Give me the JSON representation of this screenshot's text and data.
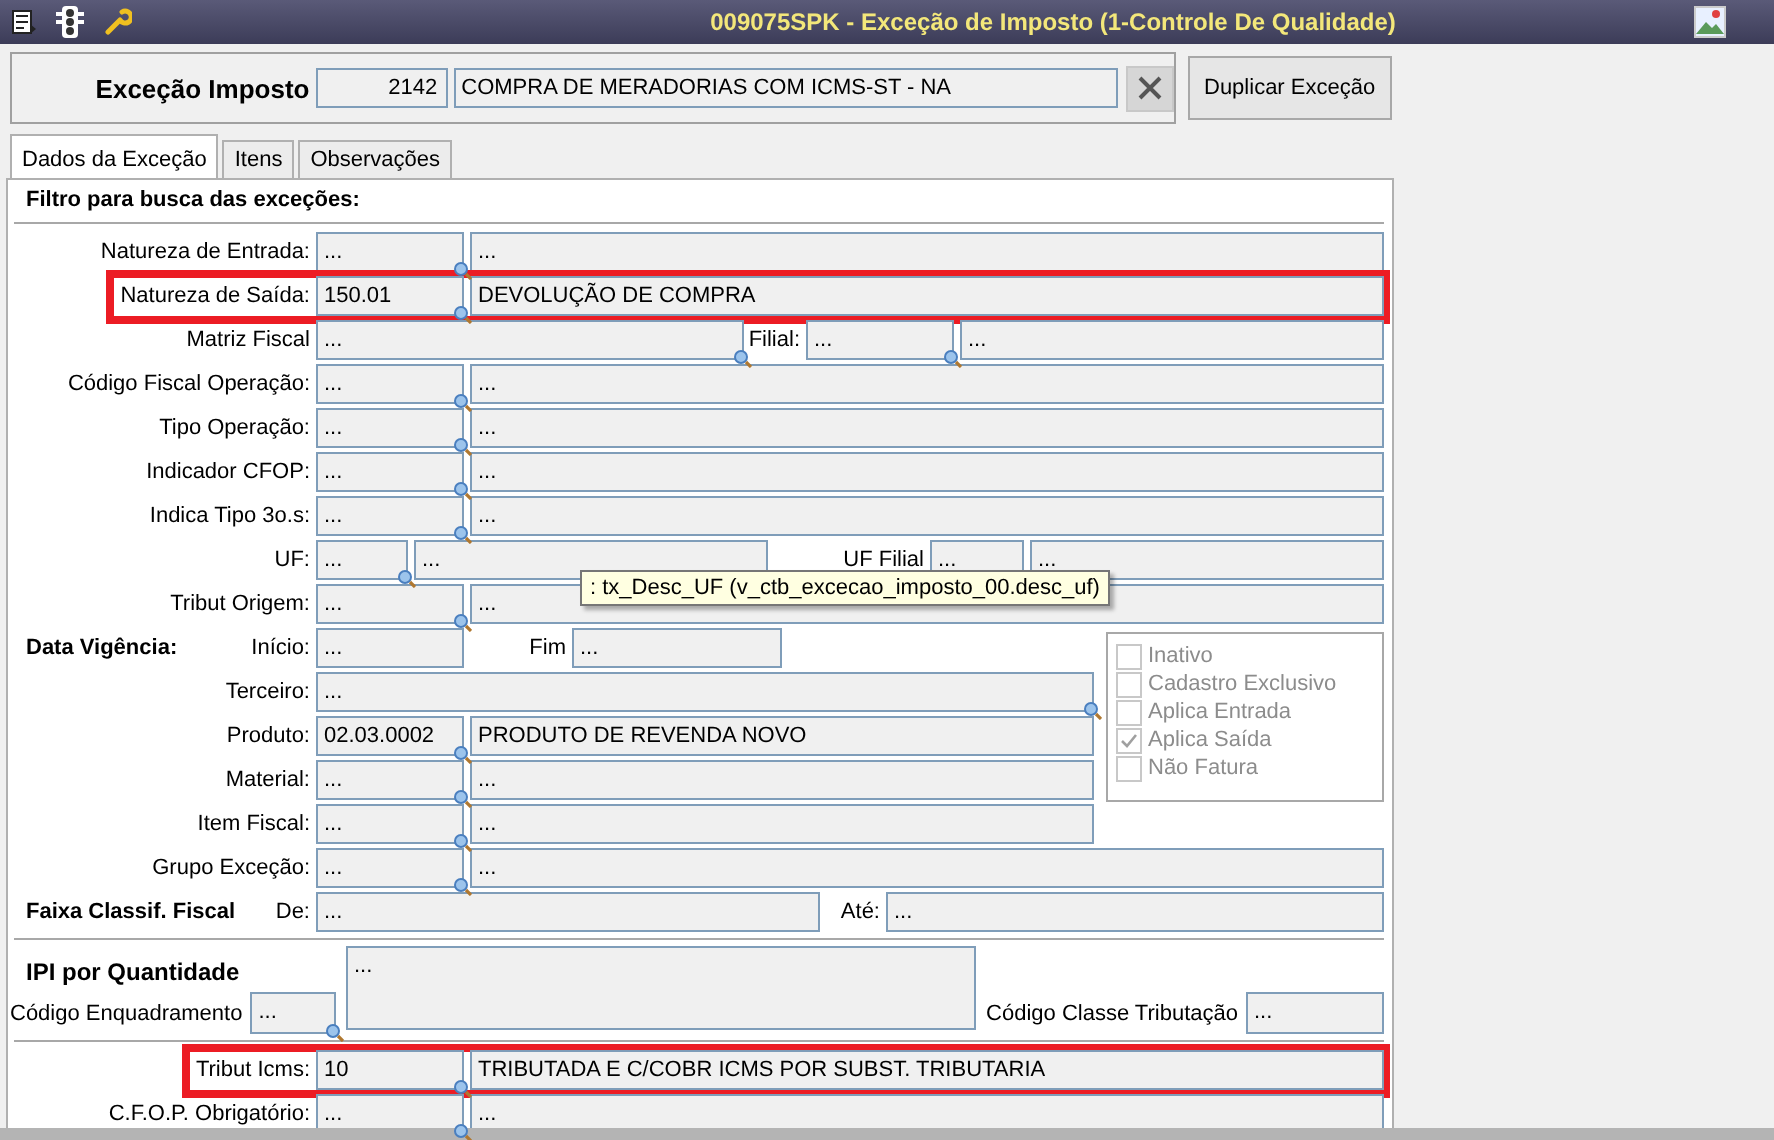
{
  "window": {
    "title": "009075SPK - Exceção de Imposto (1-Controle De Qualidade)"
  },
  "header": {
    "label": "Exceção Imposto",
    "code": "2142",
    "description": "COMPRA DE MERADORIAS COM ICMS-ST - NA",
    "duplicate_button": "Duplicar Exceção"
  },
  "tabs": [
    {
      "label": "Dados da Exceção",
      "selected": true
    },
    {
      "label": "Itens",
      "selected": false
    },
    {
      "label": "Observações",
      "selected": false
    }
  ],
  "filter": {
    "heading": "Filtro para busca das exceções:",
    "rows_top": [
      {
        "kind": "lookup",
        "highlighted": false,
        "cells": [
          {
            "kind": "label",
            "text": "Natureza de Entrada:"
          },
          {
            "kind": "field",
            "value": "...",
            "lookup": true
          },
          {
            "kind": "field",
            "value": "..."
          }
        ]
      },
      {
        "kind": "lookup",
        "highlighted": true,
        "cells": [
          {
            "kind": "label",
            "text": "Natureza de Saída:"
          },
          {
            "kind": "field",
            "value": "150.01",
            "lookup": true
          },
          {
            "kind": "field",
            "value": "DEVOLUÇÃO DE COMPRA"
          }
        ]
      },
      {
        "kind": "matriz",
        "highlighted": false,
        "cells": [
          {
            "kind": "label",
            "text": "Matriz Fiscal"
          },
          {
            "kind": "field",
            "value": "...",
            "lookup": true
          },
          {
            "kind": "label",
            "text": "Filial:"
          },
          {
            "kind": "field",
            "value": "...",
            "lookup": true
          },
          {
            "kind": "field",
            "value": "..."
          }
        ]
      },
      {
        "kind": "lookup",
        "highlighted": false,
        "cells": [
          {
            "kind": "label",
            "text": "Código Fiscal Operação:"
          },
          {
            "kind": "field",
            "value": "...",
            "lookup": true
          },
          {
            "kind": "field",
            "value": "..."
          }
        ]
      },
      {
        "kind": "lookup",
        "highlighted": false,
        "cells": [
          {
            "kind": "label",
            "text": "Tipo Operação:"
          },
          {
            "kind": "field",
            "value": "...",
            "lookup": true
          },
          {
            "kind": "field",
            "value": "..."
          }
        ]
      },
      {
        "kind": "lookup",
        "highlighted": false,
        "cells": [
          {
            "kind": "label",
            "text": "Indicador CFOP:"
          },
          {
            "kind": "field",
            "value": "...",
            "lookup": true
          },
          {
            "kind": "field",
            "value": "..."
          }
        ]
      },
      {
        "kind": "lookup",
        "highlighted": false,
        "cells": [
          {
            "kind": "label",
            "text": "Indica Tipo 3o.s:"
          },
          {
            "kind": "field",
            "value": "...",
            "lookup": true
          },
          {
            "kind": "field",
            "value": "..."
          }
        ]
      },
      {
        "kind": "uf",
        "highlighted": false,
        "cells": [
          {
            "kind": "label",
            "text": "UF:"
          },
          {
            "kind": "field",
            "value": "...",
            "lookup": true
          },
          {
            "kind": "field",
            "value": "..."
          },
          {
            "kind": "label",
            "text": "UF Filial"
          },
          {
            "kind": "field",
            "value": "..."
          },
          {
            "kind": "field",
            "value": "..."
          }
        ]
      },
      {
        "kind": "lookup",
        "highlighted": false,
        "cells": [
          {
            "kind": "label",
            "text": "Tribut Origem:"
          },
          {
            "kind": "field",
            "value": "...",
            "lookup": true
          },
          {
            "kind": "field",
            "value": "..."
          }
        ]
      }
    ],
    "period_rows": [
      {
        "kind": "dates",
        "highlighted": false,
        "cells": [
          {
            "kind": "section",
            "text": "Data Vigência:"
          },
          {
            "kind": "label",
            "text": "Início:"
          },
          {
            "kind": "field",
            "value": "..."
          },
          {
            "kind": "label",
            "text": "Fim"
          },
          {
            "kind": "field",
            "value": "..."
          }
        ]
      },
      {
        "kind": "wide",
        "highlighted": false,
        "cells": [
          {
            "kind": "label",
            "text": "Terceiro:"
          },
          {
            "kind": "field",
            "value": "...",
            "lookup": true
          }
        ]
      },
      {
        "kind": "lookup",
        "highlighted": false,
        "cells": [
          {
            "kind": "label",
            "text": "Produto:"
          },
          {
            "kind": "field",
            "value": "02.03.0002",
            "lookup": true
          },
          {
            "kind": "field",
            "value": "PRODUTO DE REVENDA NOVO"
          }
        ]
      },
      {
        "kind": "lookup",
        "highlighted": false,
        "cells": [
          {
            "kind": "label",
            "text": "Material:"
          },
          {
            "kind": "field",
            "value": "...",
            "lookup": true
          },
          {
            "kind": "field",
            "value": "..."
          }
        ]
      },
      {
        "kind": "lookup",
        "highlighted": false,
        "cells": [
          {
            "kind": "label",
            "text": "Item Fiscal:"
          },
          {
            "kind": "field",
            "value": "...",
            "lookup": true
          },
          {
            "kind": "field",
            "value": "..."
          }
        ]
      }
    ],
    "options": [
      {
        "label": "Inativo",
        "checked": false,
        "disabled": true
      },
      {
        "label": "Cadastro Exclusivo",
        "checked": false,
        "disabled": true
      },
      {
        "label": "Aplica Entrada",
        "checked": false,
        "disabled": true
      },
      {
        "label": "Aplica Saída",
        "checked": true,
        "disabled": true
      },
      {
        "label": "Não Fatura",
        "checked": false,
        "disabled": true
      }
    ],
    "rows_bottom": [
      {
        "kind": "lookup",
        "highlighted": false,
        "cells": [
          {
            "kind": "label",
            "text": "Grupo Exceção:"
          },
          {
            "kind": "field",
            "value": "...",
            "lookup": true
          },
          {
            "kind": "field",
            "value": "..."
          }
        ]
      },
      {
        "kind": "range",
        "highlighted": false,
        "cells": [
          {
            "kind": "section",
            "text": "Faixa Classif. Fiscal"
          },
          {
            "kind": "label",
            "text": "De:"
          },
          {
            "kind": "field",
            "value": "..."
          },
          {
            "kind": "label",
            "text": "Até:"
          },
          {
            "kind": "field",
            "value": "..."
          }
        ]
      }
    ]
  },
  "ipi": {
    "heading": "IPI por Quantidade",
    "description": "...",
    "enquadramento_label": "Código Enquadramento",
    "enquadramento": "...",
    "classe_label": "Código Classe Tributação",
    "classe": "..."
  },
  "tax_rows": [
    {
      "kind": "lookup",
      "highlighted": true,
      "cells": [
        {
          "kind": "label",
          "text": "Tribut Icms:"
        },
        {
          "kind": "field",
          "value": "10",
          "lookup": true
        },
        {
          "kind": "field",
          "value": "TRIBUTADA E C/COBR ICMS POR SUBST. TRIBUTARIA"
        }
      ]
    },
    {
      "kind": "lookup",
      "highlighted": false,
      "cells": [
        {
          "kind": "label",
          "text": "C.F.O.P. Obrigatório:"
        },
        {
          "kind": "field",
          "value": "...",
          "lookup": true
        },
        {
          "kind": "field",
          "value": "..."
        }
      ]
    }
  ],
  "tooltip": {
    "text": ": tx_Desc_UF (v_ctb_excecao_imposto_00.desc_uf)"
  }
}
